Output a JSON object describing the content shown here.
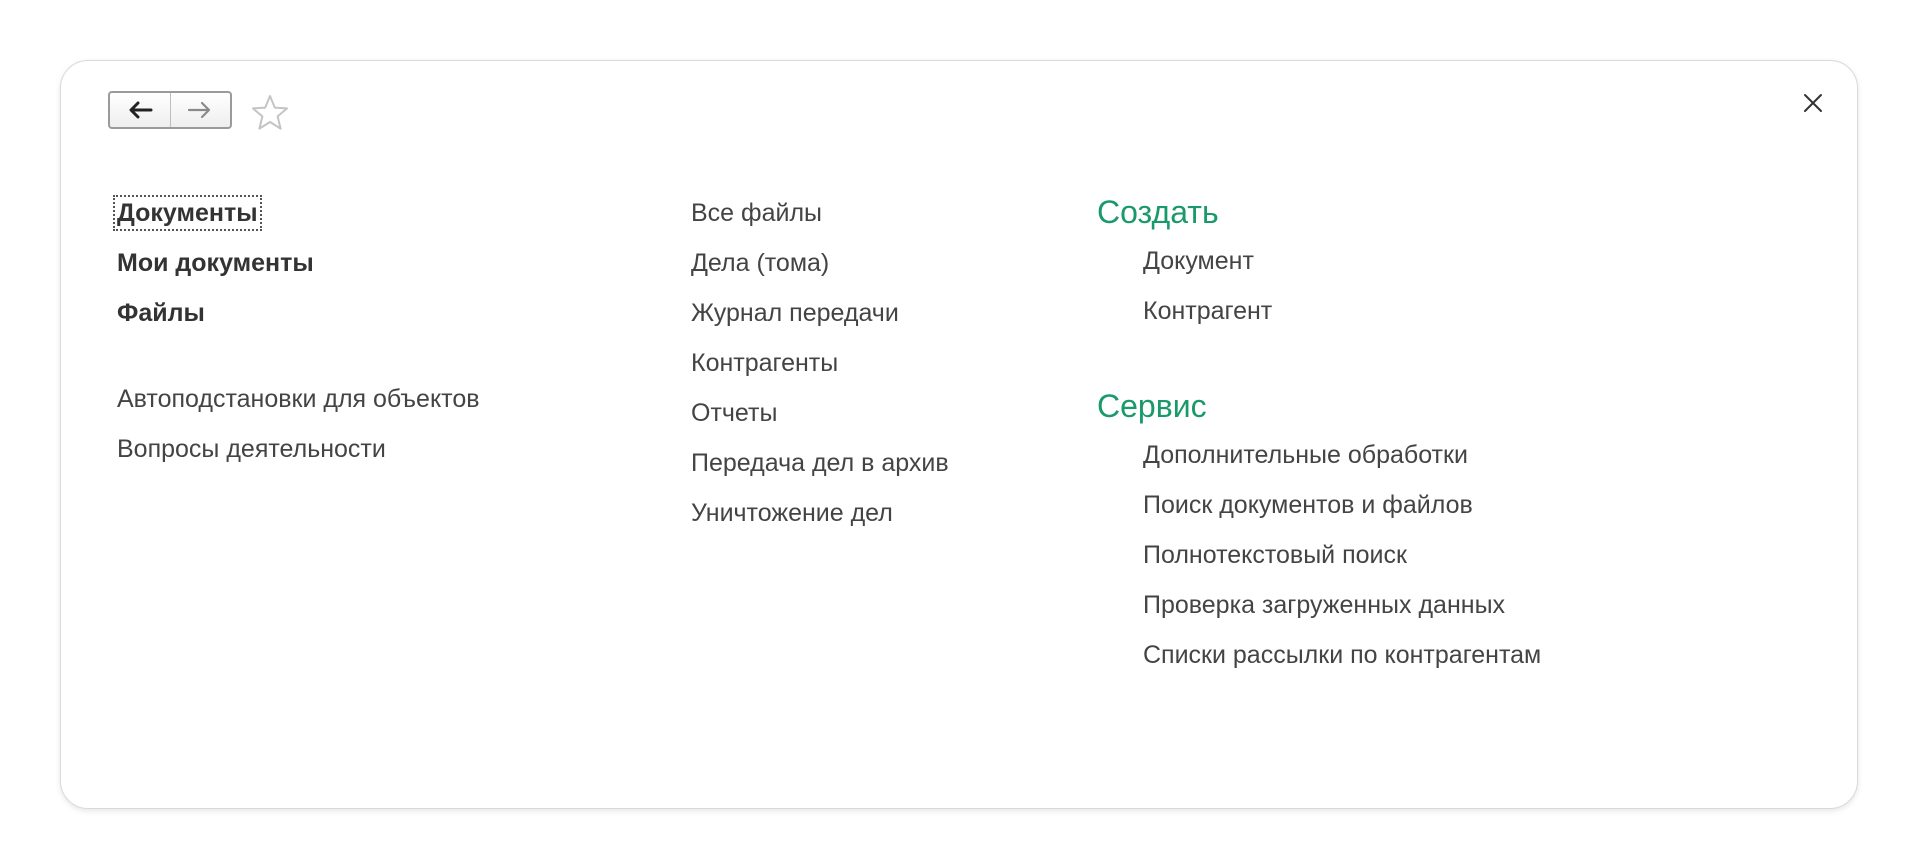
{
  "toolbar": {
    "back_icon": "arrow-left-icon",
    "forward_icon": "arrow-right-icon",
    "favorite_icon": "star-outline-icon",
    "close_icon": "close-icon"
  },
  "column1": {
    "primary": [
      "Документы",
      "Мои документы",
      "Файлы"
    ],
    "secondary": [
      "Автоподстановки для объектов",
      "Вопросы деятельности"
    ]
  },
  "column2": {
    "items": [
      "Все файлы",
      "Дела (тома)",
      "Журнал передачи",
      "Контрагенты",
      "Отчеты",
      "Передача дел в архив",
      "Уничтожение дел"
    ]
  },
  "column3": {
    "create": {
      "title": "Создать",
      "items": [
        "Документ",
        "Контрагент"
      ]
    },
    "service": {
      "title": "Сервис",
      "items": [
        "Дополнительные обработки",
        "Поиск документов и файлов",
        "Полнотекстовый поиск",
        "Проверка загруженных данных",
        "Списки рассылки по контрагентам"
      ]
    }
  },
  "colors": {
    "section_title": "#1a9a6b",
    "text": "#333333",
    "border": "#d9d9d9"
  }
}
